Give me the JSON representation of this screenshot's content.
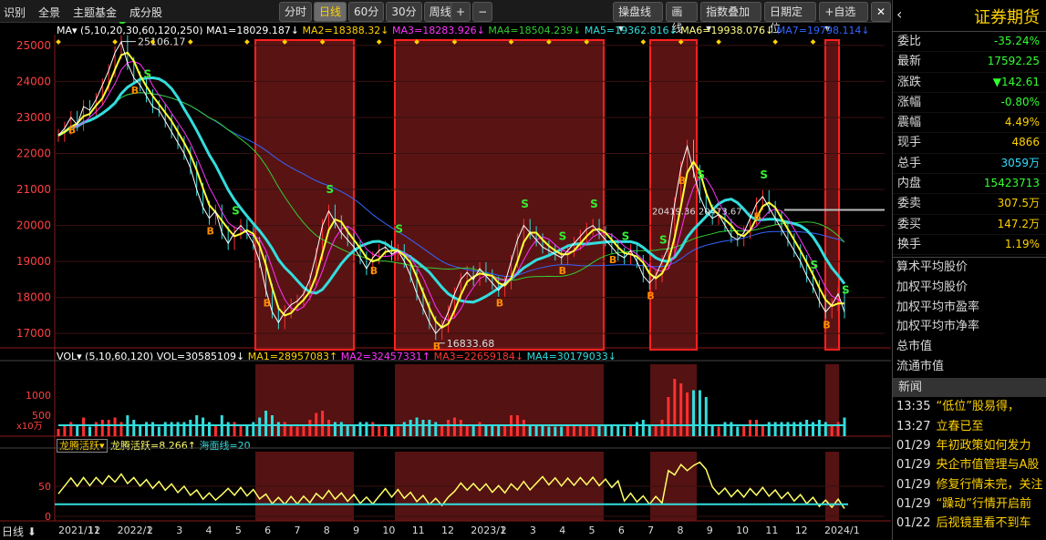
{
  "toolbar": {
    "left": [
      "识别",
      "全景",
      "主题基金",
      "成分股"
    ],
    "periods": [
      "分时",
      "日线",
      "60分",
      "30分"
    ],
    "active_period": "日线",
    "week_label": "周线",
    "plus": "+",
    "minus": "−",
    "right": [
      "操盘线",
      "画线",
      "指数叠加",
      "日期定位",
      "+自选"
    ],
    "close": "✕"
  },
  "ma_legend": {
    "label": "MA",
    "params": "(5,10,20,30,60,120,250)",
    "items": [
      {
        "text": "MA1=18029.187↓",
        "color": "#ffffff"
      },
      {
        "text": "MA2=18388.32↓",
        "color": "#ffd200"
      },
      {
        "text": "MA3=18283.926↓",
        "color": "#ff33ff"
      },
      {
        "text": "MA4=18504.239↓",
        "color": "#33cc33"
      },
      {
        "text": "MA5=19362.816↓",
        "color": "#33dddd"
      },
      {
        "text": "MA6=19938.076↓",
        "color": "#ffff88"
      },
      {
        "text": "MA7=19798.114↓",
        "color": "#3366ff"
      }
    ]
  },
  "vol_legend": {
    "label": "VOL",
    "params": "(5,10,60,120)",
    "items": [
      {
        "text": "VOL=30585109↓",
        "color": "#ffffff"
      },
      {
        "text": "MA1=28957083↑",
        "color": "#ffd200"
      },
      {
        "text": "MA2=32457331↑",
        "color": "#ff33ff"
      },
      {
        "text": "MA3=22659184↓",
        "color": "#ff3333"
      },
      {
        "text": "MA4=30179033↓",
        "color": "#33dddd"
      }
    ],
    "unit": "x10万"
  },
  "dl_legend": {
    "label": "龙腾活跃",
    "items": [
      {
        "text": "龙腾活跃=8.266↑",
        "color": "#ffff66"
      },
      {
        "text": "海面线=20",
        "color": "#33dddd"
      }
    ]
  },
  "price_axis": [
    "25000",
    "24000",
    "23000",
    "22000",
    "21000",
    "20000",
    "19000",
    "18000",
    "17000"
  ],
  "vol_axis": [
    "1000",
    "500"
  ],
  "dl_axis": [
    "50",
    "0"
  ],
  "chart_annotations": {
    "high": "25106.17",
    "low": "16833.68",
    "mid1": "20419.36",
    "mid2": "20473.67"
  },
  "x_labels": [
    "2021/11",
    "12",
    "2022/1",
    "2",
    "3",
    "4",
    "5",
    "6",
    "7",
    "8",
    "9",
    "10",
    "11",
    "12",
    "2023/1",
    "2",
    "3",
    "4",
    "5",
    "6",
    "7",
    "8",
    "9",
    "10",
    "11",
    "12",
    "2024/1"
  ],
  "x_mode": "日线",
  "right_panel": {
    "title": "证券期货",
    "back": "‹",
    "rows": [
      {
        "label": "委比",
        "value": "-35.24%",
        "color": "#33ff33"
      },
      {
        "label": "最新",
        "value": "17592.25",
        "color": "#33ff33"
      },
      {
        "label": "涨跌",
        "value": "▼142.61",
        "color": "#33ff33"
      },
      {
        "label": "涨幅",
        "value": "-0.80%",
        "color": "#33ff33"
      },
      {
        "label": "震幅",
        "value": "4.49%",
        "color": "#ffd200"
      },
      {
        "label": "现手",
        "value": "4866",
        "color": "#ffd200"
      },
      {
        "label": "总手",
        "value": "3059万",
        "color": "#33ddff"
      },
      {
        "label": "内盘",
        "value": "15423713",
        "color": "#33ff33"
      },
      {
        "label": "委卖",
        "value": "307.5万",
        "color": "#ffd200"
      },
      {
        "label": "委买",
        "value": "147.2万",
        "color": "#ffd200"
      },
      {
        "label": "换手",
        "value": "1.19%",
        "color": "#ffd200"
      }
    ],
    "extra": [
      "算术平均股价",
      "加权平均股价",
      "加权平均市盈率",
      "加权平均市净率",
      "总市值",
      "流通市值"
    ],
    "news_title": "新闻",
    "news": [
      {
        "time": "13:35",
        "text": "“低位”股易得，"
      },
      {
        "time": "13:27",
        "text": "立春已至"
      },
      {
        "time": "01/29",
        "text": "年初政策如何发力"
      },
      {
        "time": "01/29",
        "text": "央企市值管理与A股"
      },
      {
        "time": "01/29",
        "text": "修复行情未完，关注"
      },
      {
        "time": "01/29",
        "text": "“躁动”行情开启前"
      },
      {
        "time": "01/22",
        "text": "后视镜里看不到车"
      }
    ]
  },
  "chart_data": {
    "type": "line",
    "title": "",
    "y_range": [
      16600,
      25300
    ],
    "closes": [
      22500,
      22700,
      23000,
      22800,
      23300,
      23200,
      23500,
      23900,
      24300,
      24800,
      25100,
      24500,
      24100,
      23900,
      23600,
      23300,
      23200,
      22900,
      22600,
      22300,
      22000,
      21600,
      21000,
      20500,
      20200,
      20400,
      19800,
      19500,
      19800,
      20000,
      19800,
      19500,
      19000,
      18200,
      17600,
      17300,
      17600,
      17800,
      17900,
      18100,
      18500,
      19200,
      20000,
      20400,
      20100,
      19800,
      19600,
      19400,
      19100,
      18800,
      19100,
      19300,
      19400,
      19200,
      19300,
      19000,
      18600,
      18100,
      17700,
      17300,
      17000,
      17200,
      17600,
      18100,
      18500,
      18700,
      18500,
      18800,
      18600,
      18400,
      18200,
      18400,
      19000,
      19600,
      20000,
      19800,
      19600,
      19400,
      19300,
      19200,
      19100,
      19300,
      19500,
      19700,
      19900,
      20000,
      19800,
      19600,
      19400,
      19200,
      19100,
      19300,
      19000,
      18600,
      18400,
      18600,
      19000,
      19400,
      20600,
      21600,
      22200,
      21500,
      20800,
      20400,
      20200,
      20300,
      20000,
      19700,
      19600,
      19800,
      20200,
      20600,
      20800,
      20500,
      20200,
      19900,
      19600,
      19300,
      19000,
      18600,
      18300,
      17900,
      17600,
      17800,
      18100,
      17600
    ]
  }
}
